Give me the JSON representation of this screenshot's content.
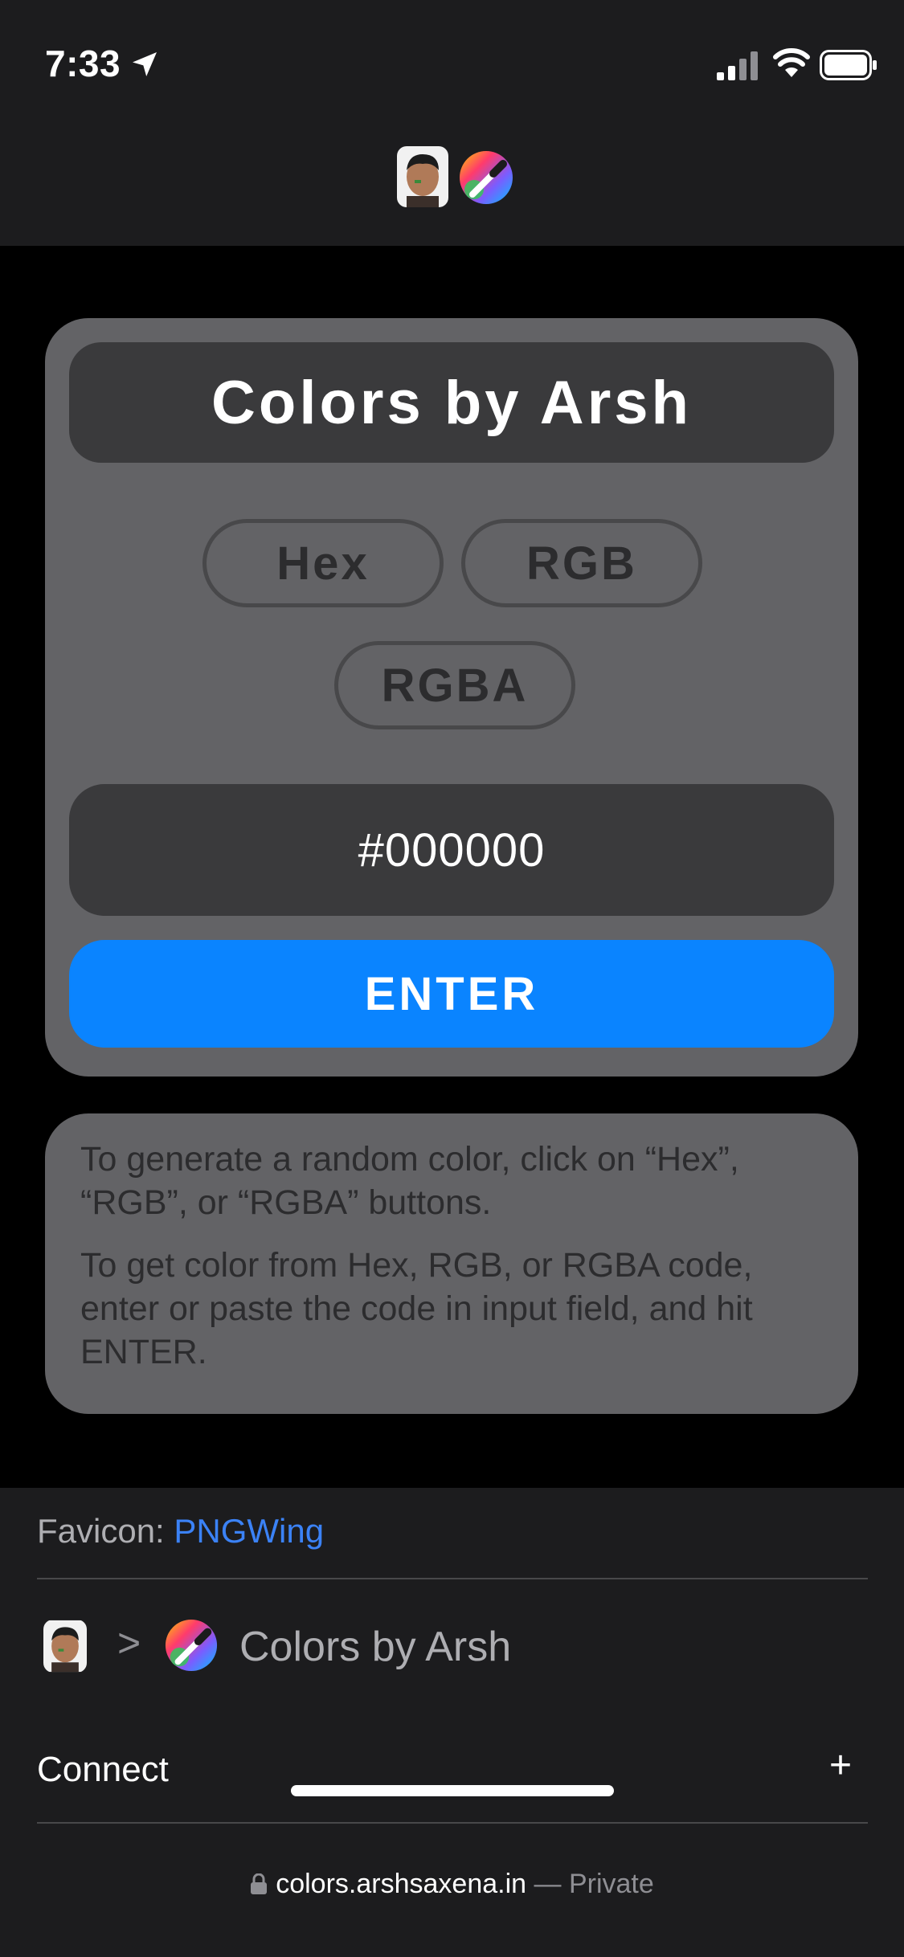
{
  "status_bar": {
    "time": "7:33"
  },
  "app": {
    "title": "Colors by Arsh",
    "buttons": [
      "Hex",
      "RGB",
      "RGBA"
    ],
    "input": {
      "value": "#000000"
    },
    "enter_label": "ENTER"
  },
  "info": {
    "paragraph1": "To generate a random color, click on “Hex”, “RGB”, or “RGBA” buttons.",
    "paragraph2": "To get color from Hex, RGB, or RGBA code, enter or paste the code in input field, and hit ENTER."
  },
  "footer": {
    "favicon_label": "Favicon:",
    "favicon_link": "PNGWing",
    "breadcrumb_separator": ">",
    "breadcrumb_title": "Colors by Arsh",
    "connect_label": "Connect",
    "connect_toggle": "+"
  },
  "browser": {
    "url": "colors.arshsaxena.in",
    "mode": "— Private"
  },
  "colors": {
    "accent": "#0a84ff",
    "card": "#636366",
    "surface": "#3a3a3c",
    "bar": "#1c1c1e"
  }
}
